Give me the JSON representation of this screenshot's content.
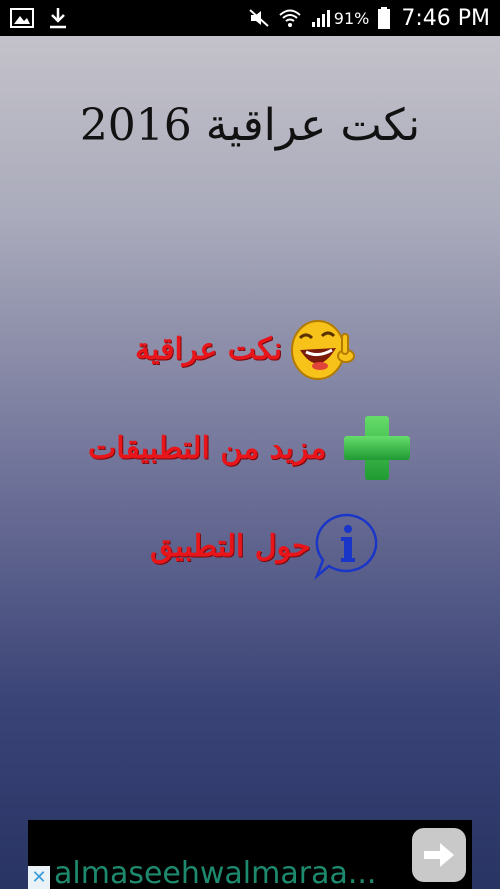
{
  "status_bar": {
    "left_icons": [
      "image-icon",
      "download-icon"
    ],
    "right_icons": [
      "mute-icon",
      "wifi-icon",
      "signal-icon",
      "battery-icon"
    ],
    "battery": "91%",
    "time": "7:46 PM"
  },
  "app": {
    "title": "نكت عراقية 2016"
  },
  "menu": {
    "items": [
      {
        "label": "نكت عراقية",
        "icon": "laughing-emoji-icon"
      },
      {
        "label": "مزيد من التطبيقات",
        "icon": "plus-icon"
      },
      {
        "label": "حول التطبيق",
        "icon": "info-icon"
      }
    ]
  },
  "ad": {
    "text": "almaseehwalmaraa...",
    "close_glyph": "✕",
    "go_icon": "arrow-right-icon"
  },
  "colors": {
    "menu_text": "#e8151b",
    "plus_green": "#2db44a",
    "info_blue": "#1a36c8",
    "ad_text": "#1d8a6e"
  }
}
